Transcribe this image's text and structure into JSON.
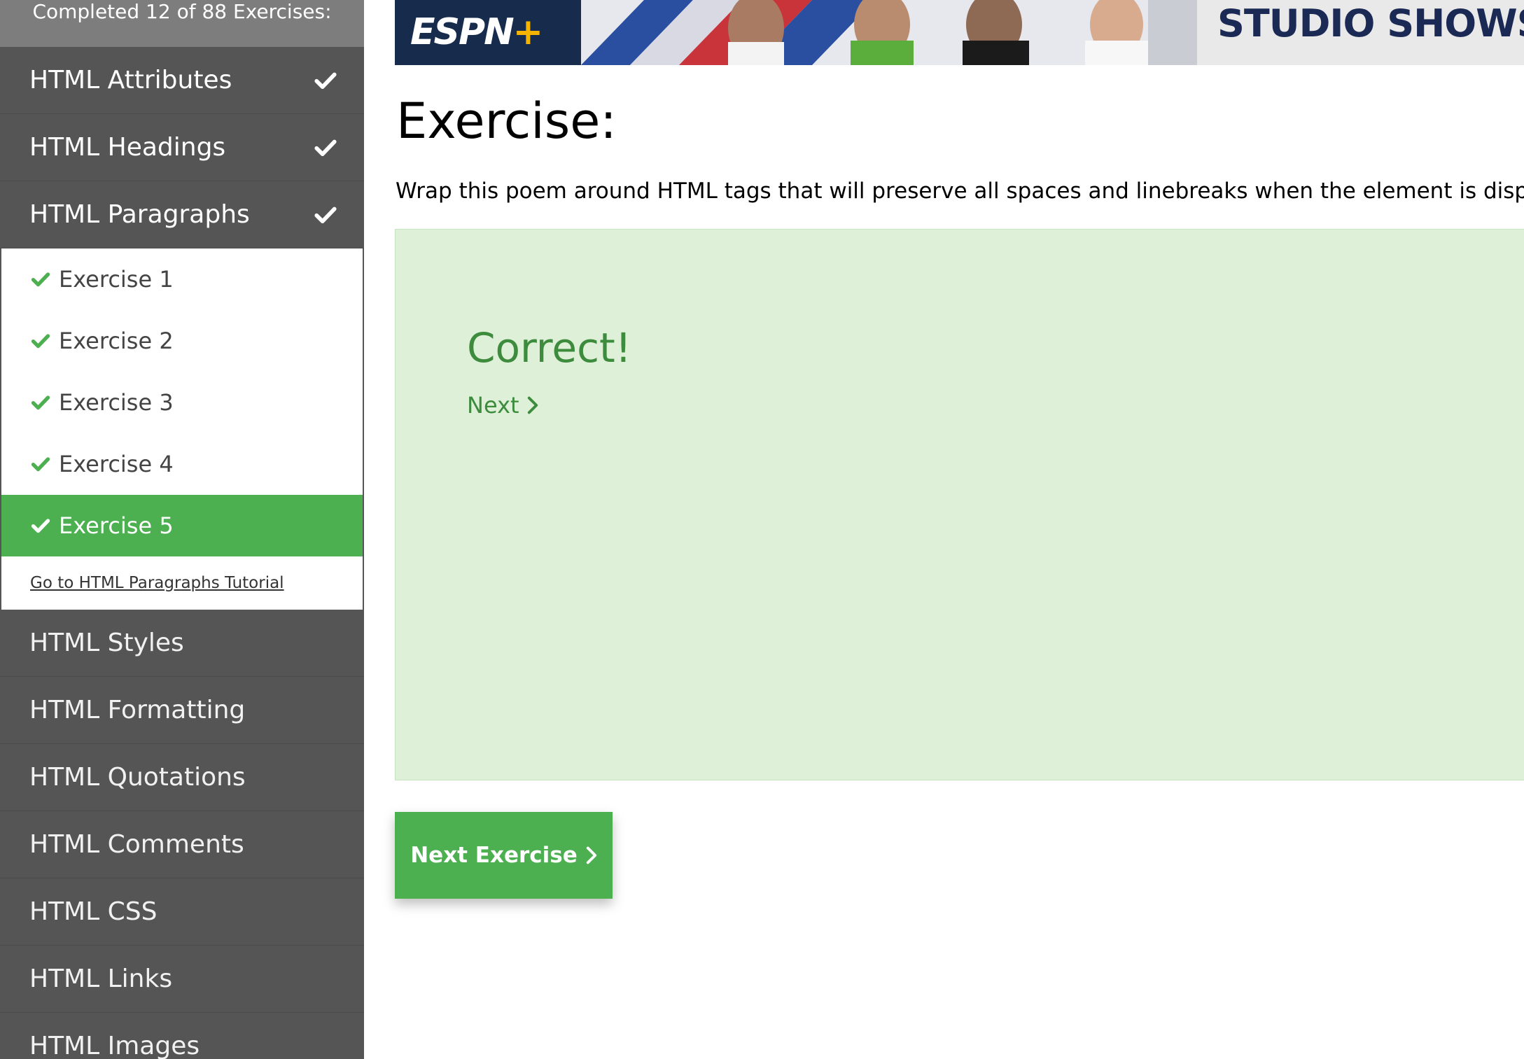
{
  "sidebar": {
    "progress_text": "Completed 12 of 88 Exercises:",
    "sections_top": [
      {
        "label": "HTML Attributes",
        "checked": true
      },
      {
        "label": "HTML Headings",
        "checked": true
      },
      {
        "label": "HTML Paragraphs",
        "checked": true
      }
    ],
    "exercises": [
      {
        "label": "Exercise 1"
      },
      {
        "label": "Exercise 2"
      },
      {
        "label": "Exercise 3"
      },
      {
        "label": "Exercise 4"
      },
      {
        "label": "Exercise 5"
      }
    ],
    "tutorial_link": "Go to HTML Paragraphs Tutorial",
    "sections_bottom": [
      {
        "label": "HTML Styles"
      },
      {
        "label": "HTML Formatting"
      },
      {
        "label": "HTML Quotations"
      },
      {
        "label": "HTML Comments"
      },
      {
        "label": "HTML CSS"
      },
      {
        "label": "HTML Links"
      },
      {
        "label": "HTML Images"
      }
    ]
  },
  "banner": {
    "logo_text": "ESPN",
    "logo_plus": "+",
    "headline": "STUDIO SHOWS."
  },
  "main": {
    "title": "Exercise:",
    "instruction": "Wrap this poem around HTML tags that will preserve all spaces and linebreaks when the element is display",
    "result_heading": "Correct!",
    "next_link": "Next",
    "next_button": "Next Exercise"
  },
  "colors": {
    "sidebar_bg": "#555555",
    "accent_green": "#4caf50",
    "success_bg": "#dff0d8",
    "success_text": "#3d8b3d"
  },
  "icons": {
    "section_check": "check-icon",
    "exercise_check": "check-icon",
    "next_chevron": "chevron-right-icon"
  }
}
